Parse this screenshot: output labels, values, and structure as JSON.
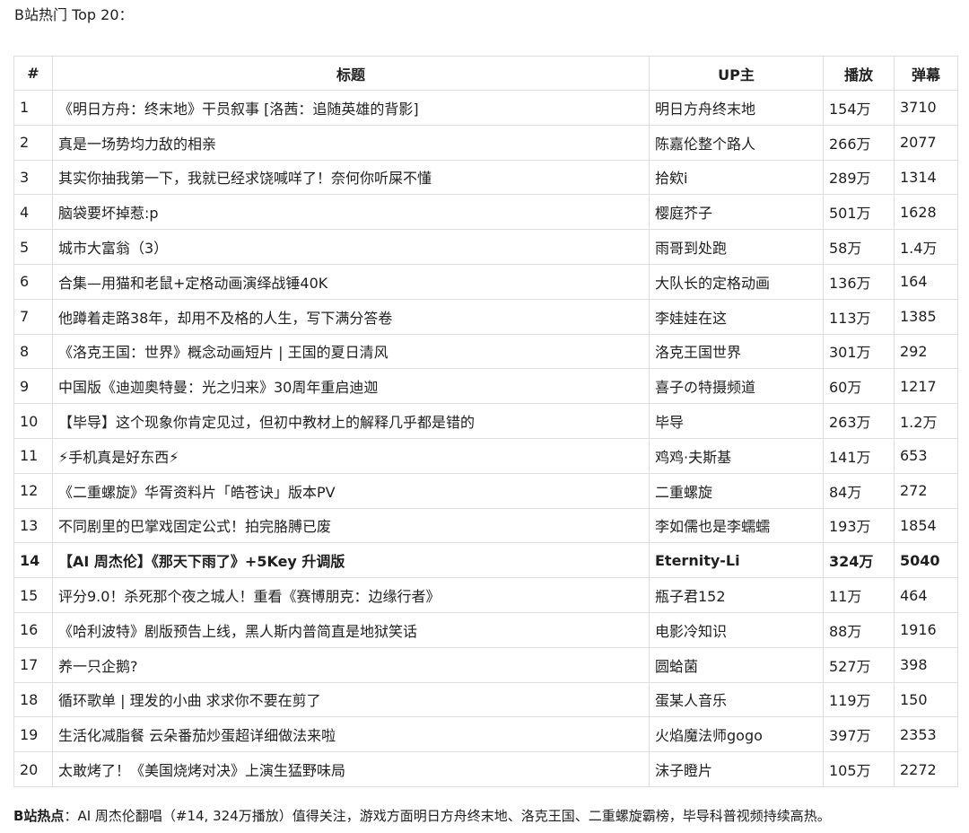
{
  "intro": "B站热门 Top 20：",
  "table": {
    "headers": {
      "index": "#",
      "title": "标题",
      "uploader": "UP主",
      "plays": "播放",
      "danmaku": "弹幕"
    },
    "rows": [
      {
        "index": "1",
        "title": "《明日方舟：终末地》干员叙事 [洛茜：追随英雄的背影]",
        "uploader": "明日方舟终末地",
        "plays": "154万",
        "danmaku": "3710"
      },
      {
        "index": "2",
        "title": "真是一场势均力敌的相亲",
        "uploader": "陈嘉伦整个路人",
        "plays": "266万",
        "danmaku": "2077"
      },
      {
        "index": "3",
        "title": "其实你抽我第一下，我就已经求饶喊咩了！奈何你听屎不懂",
        "uploader": "拾欸i",
        "plays": "289万",
        "danmaku": "1314"
      },
      {
        "index": "4",
        "title": "脑袋要坏掉惹:p",
        "uploader": "樱庭芥子",
        "plays": "501万",
        "danmaku": "1628"
      },
      {
        "index": "5",
        "title": "城市大富翁（3）",
        "uploader": "雨哥到处跑",
        "plays": "58万",
        "danmaku": "1.4万"
      },
      {
        "index": "6",
        "title": "合集—用猫和老鼠+定格动画演绎战锤40K",
        "uploader": "大队长的定格动画",
        "plays": "136万",
        "danmaku": "164"
      },
      {
        "index": "7",
        "title": "他蹲着走路38年，却用不及格的人生，写下满分答卷",
        "uploader": "李娃娃在这",
        "plays": "113万",
        "danmaku": "1385"
      },
      {
        "index": "8",
        "title": "《洛克王国：世界》概念动画短片 | 王国的夏日清风",
        "uploader": "洛克王国世界",
        "plays": "301万",
        "danmaku": "292"
      },
      {
        "index": "9",
        "title": "中国版《迪迦奥特曼：光之归来》30周年重启迪迦",
        "uploader": "喜子の特摄频道",
        "plays": "60万",
        "danmaku": "1217"
      },
      {
        "index": "10",
        "title": "【毕导】这个现象你肯定见过，但初中教材上的解释几乎都是错的",
        "uploader": "毕导",
        "plays": "263万",
        "danmaku": "1.2万"
      },
      {
        "index": "11",
        "title": "⚡手机真是好东西⚡",
        "uploader": "鸡鸡·夫斯基",
        "plays": "141万",
        "danmaku": "653"
      },
      {
        "index": "12",
        "title": "《二重螺旋》华胥资料片「皓苍诀」版本PV",
        "uploader": "二重螺旋",
        "plays": "84万",
        "danmaku": "272"
      },
      {
        "index": "13",
        "title": "不同剧里的巴掌戏固定公式！拍完胳膊已废",
        "uploader": "李如儒也是李蠕蠕",
        "plays": "193万",
        "danmaku": "1854"
      },
      {
        "index": "14",
        "title": "【AI 周杰伦】《那天下雨了》+5Key 升调版",
        "uploader": "Eternity-Li",
        "plays": "324万",
        "danmaku": "5040"
      },
      {
        "index": "15",
        "title": "评分9.0！杀死那个夜之城人！重看《赛博朋克：边缘行者》",
        "uploader": "瓶子君152",
        "plays": "11万",
        "danmaku": "464"
      },
      {
        "index": "16",
        "title": "《哈利波特》剧版预告上线，黑人斯内普简直是地狱笑话",
        "uploader": "电影冷知识",
        "plays": "88万",
        "danmaku": "1916"
      },
      {
        "index": "17",
        "title": "养一只企鹅?",
        "uploader": "圆蛤菌",
        "plays": "527万",
        "danmaku": "398"
      },
      {
        "index": "18",
        "title": "循环歌单 | 理发的小曲 求求你不要在剪了",
        "uploader": "蛋某人音乐",
        "plays": "119万",
        "danmaku": "150"
      },
      {
        "index": "19",
        "title": "生活化减脂餐 云朵番茄炒蛋超详细做法来啦",
        "uploader": "火焰魔法师gogo",
        "plays": "397万",
        "danmaku": "2353"
      },
      {
        "index": "20",
        "title": "太敢烤了！《美国烧烤对决》上演生猛野味局",
        "uploader": "沫子瞪片",
        "plays": "105万",
        "danmaku": "2272"
      }
    ]
  },
  "summary": {
    "label": "B站热点",
    "text": "：AI 周杰伦翻唱（#14, 324万播放）值得关注，游戏方面明日方舟终末地、洛克王国、二重螺旋霸榜，毕导科普视频持续高热。"
  }
}
